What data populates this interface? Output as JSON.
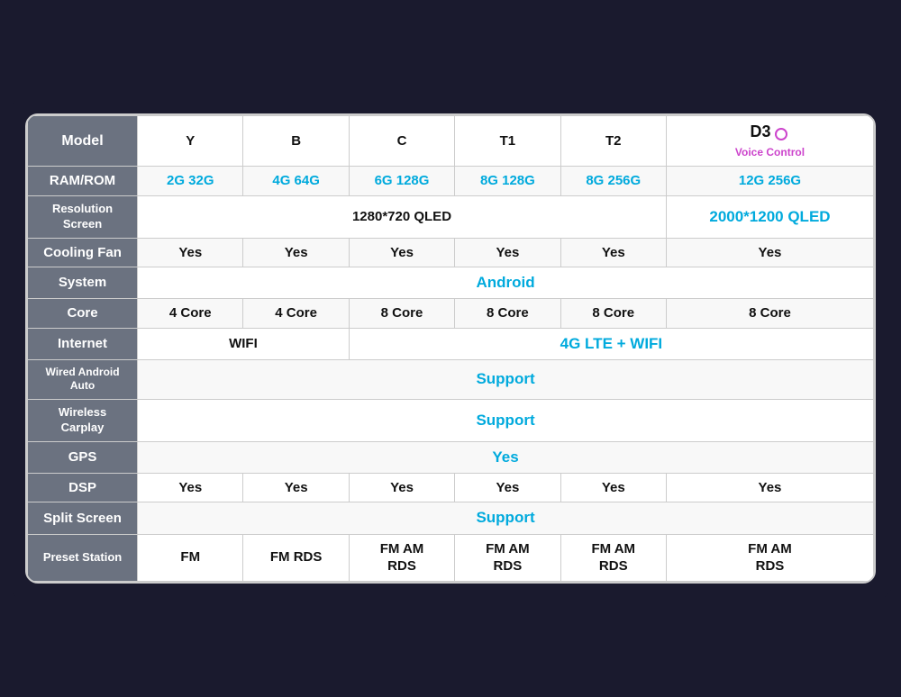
{
  "table": {
    "headers": {
      "label": "Model",
      "cols": [
        "Y",
        "B",
        "C",
        "T1",
        "T2",
        "D3"
      ]
    },
    "rows": [
      {
        "header": "RAM/ROM",
        "cells": [
          "2G 32G",
          "4G 64G",
          "6G 128G",
          "8G 128G",
          "8G 256G",
          "12G 256G"
        ],
        "cyan": true
      },
      {
        "header": "Resolution\nScreen",
        "cells_grouped": [
          {
            "span": 5,
            "text": "1280*720 QLED",
            "cyan": false
          },
          {
            "span": 1,
            "text": "2000*1200 QLED",
            "cyan": true
          }
        ]
      },
      {
        "header": "Cooling Fan",
        "cells": [
          "Yes",
          "Yes",
          "Yes",
          "Yes",
          "Yes",
          "Yes"
        ]
      },
      {
        "header": "System",
        "cells_grouped": [
          {
            "span": 6,
            "text": "Android",
            "cyan": true
          }
        ]
      },
      {
        "header": "Core",
        "cells": [
          "4 Core",
          "4 Core",
          "8 Core",
          "8 Core",
          "8 Core",
          "8 Core"
        ]
      },
      {
        "header": "Internet",
        "cells_grouped": [
          {
            "span": 2,
            "text": "WIFI",
            "cyan": false
          },
          {
            "span": 4,
            "text": "4G LTE + WIFI",
            "cyan": true
          }
        ]
      },
      {
        "header": "Wired Android\nAuto",
        "cells_grouped": [
          {
            "span": 6,
            "text": "Support",
            "cyan": true
          }
        ]
      },
      {
        "header": "Wireless\nCarplay",
        "cells_grouped": [
          {
            "span": 6,
            "text": "Support",
            "cyan": true
          }
        ]
      },
      {
        "header": "GPS",
        "cells_grouped": [
          {
            "span": 6,
            "text": "Yes",
            "cyan": true
          }
        ]
      },
      {
        "header": "DSP",
        "cells": [
          "Yes",
          "Yes",
          "Yes",
          "Yes",
          "Yes",
          "Yes"
        ]
      },
      {
        "header": "Split Screen",
        "cells_grouped": [
          {
            "span": 6,
            "text": "Support",
            "cyan": true
          }
        ]
      },
      {
        "header": "Preset Station",
        "cells": [
          "FM",
          "FM RDS",
          "FM AM\nRDS",
          "FM AM\nRDS",
          "FM AM\nRDS",
          "FM AM\nRDS"
        ]
      }
    ]
  }
}
